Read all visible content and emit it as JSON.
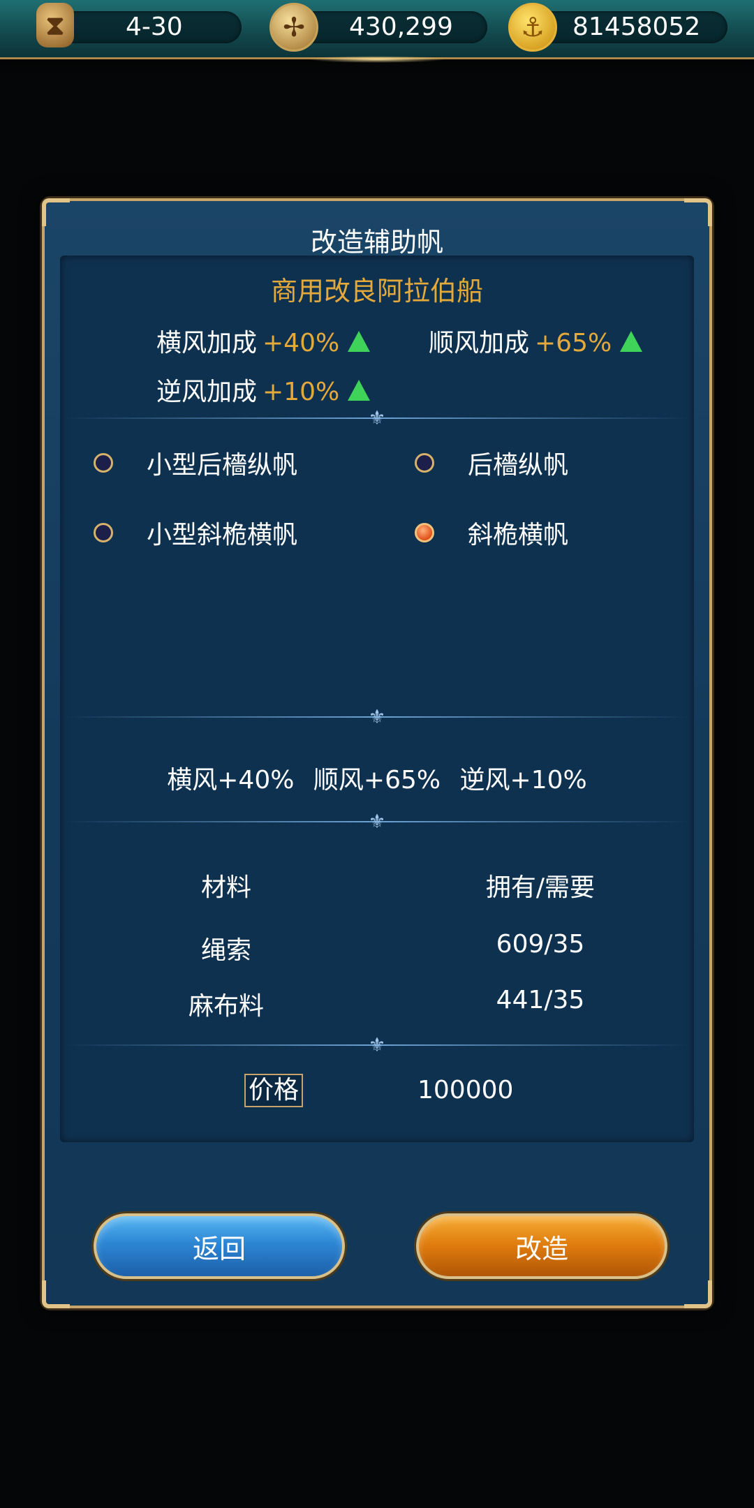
{
  "topbar": {
    "date": "4-30",
    "fame": "430,299",
    "gold": "81458052",
    "icons": [
      "hourglass-icon",
      "compass-icon",
      "gold-coin-icon"
    ]
  },
  "dialog": {
    "title": "改造辅助帆",
    "ship_name": "商用改良阿拉伯船",
    "stats": [
      {
        "label": "横风加成",
        "value": "+40%"
      },
      {
        "label": "顺风加成",
        "value": "+65%"
      },
      {
        "label": "逆风加成",
        "value": "+10%"
      }
    ],
    "options": [
      {
        "label": "小型后檣纵帆",
        "selected": false
      },
      {
        "label": "后檣纵帆",
        "selected": false
      },
      {
        "label": "小型斜桅横帆",
        "selected": false
      },
      {
        "label": "斜桅横帆",
        "selected": true
      }
    ],
    "summary": [
      "横风+40%",
      "顺风+65%",
      "逆风+10%"
    ],
    "materials": {
      "header_material": "材料",
      "header_amount": "拥有/需要",
      "rows": [
        {
          "name": "绳索",
          "amount": "609/35"
        },
        {
          "name": "麻布料",
          "amount": "441/35"
        }
      ]
    },
    "price_label": "价格",
    "price_value": "100000",
    "back_label": "返回",
    "confirm_label": "改造"
  },
  "colors": {
    "accent_gold": "#e3a93a",
    "up_green": "#3fd35a",
    "selected_radio": "#e0501a"
  }
}
